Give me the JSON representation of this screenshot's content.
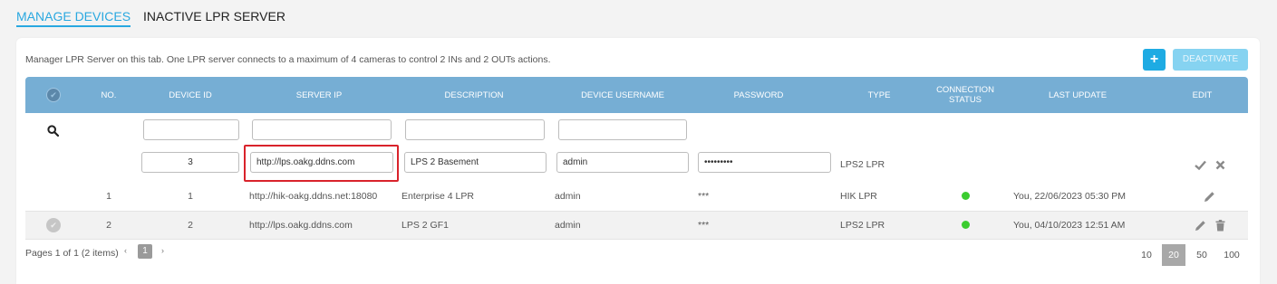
{
  "tabs": [
    {
      "label": "MANAGE DEVICES"
    },
    {
      "label": "INACTIVE LPR SERVER"
    }
  ],
  "description": "Manager LPR Server on this tab. One LPR server connects to a maximum of 4 cameras to control 2 INs and 2 OUTs actions.",
  "toolbar": {
    "add_label": "+",
    "deactivate_label": "DEACTIVATE"
  },
  "columns": {
    "no": "NO.",
    "device_id": "DEVICE ID",
    "server_ip": "SERVER IP",
    "description": "DESCRIPTION",
    "device_username": "DEVICE USERNAME",
    "password": "PASSWORD",
    "type": "TYPE",
    "connection_status_1": "CONNECTION",
    "connection_status_2": "STATUS",
    "last_update": "LAST UPDATE",
    "edit": "EDIT"
  },
  "edit_row": {
    "device_id": "3",
    "server_ip": "http://lps.oakg.ddns.com",
    "description": "LPS 2 Basement",
    "username": "admin",
    "password": "•••••••••",
    "type": "LPS2 LPR"
  },
  "rows": [
    {
      "no": "1",
      "device_id": "1",
      "server_ip": "http://hik-oakg.ddns.net:18080",
      "description": "Enterprise 4 LPR",
      "username": "admin",
      "password": "***",
      "type": "HIK LPR",
      "status": "online",
      "last_update": "You, 22/06/2023 05:30 PM"
    },
    {
      "no": "2",
      "device_id": "2",
      "server_ip": "http://lps.oakg.ddns.com",
      "description": "LPS 2 GF1",
      "username": "admin",
      "password": "***",
      "type": "LPS2 LPR",
      "status": "online",
      "last_update": "You, 04/10/2023 12:51 AM"
    }
  ],
  "pager": {
    "summary": "Pages 1 of 1 (2 items)",
    "current_page": "1",
    "prev": "‹",
    "next": "›",
    "page_sizes": [
      "10",
      "20",
      "50",
      "100"
    ],
    "active_size": "20"
  },
  "colors": {
    "accent": "#29a8e0",
    "header": "#76aed4",
    "status_online": "#3bcc2f",
    "highlight": "#d9232b"
  },
  "icons": {
    "search": "search-icon",
    "confirm": "check-icon",
    "cancel": "close-icon",
    "edit": "pencil-icon",
    "delete": "trash-icon"
  }
}
